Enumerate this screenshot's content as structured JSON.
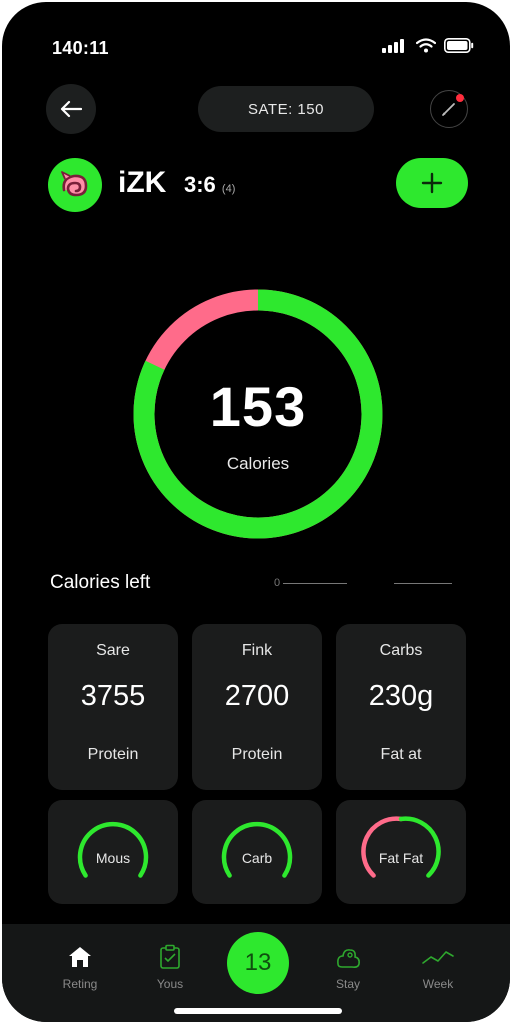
{
  "colors": {
    "accent": "#2ee82e",
    "ring_secondary": "#ff6b8a",
    "background": "#000000",
    "card": "#1b1c1c"
  },
  "status_bar": {
    "time": "140:11"
  },
  "header": {
    "date_label": "SATE: 150"
  },
  "profile": {
    "name": "iZK",
    "value": "3:6",
    "unit": "(4)"
  },
  "summary": {
    "value": "153",
    "label": "Calories",
    "progress_fraction": 0.82
  },
  "section": {
    "title": "Calories left",
    "legend_a": "0"
  },
  "cards": [
    {
      "title": "Sare",
      "value": "3755",
      "sub": "Protein"
    },
    {
      "title": "Fink",
      "value": "2700",
      "sub": "Protein"
    },
    {
      "title": "Carbs",
      "value": "230g",
      "sub": "Fat at"
    }
  ],
  "gauges": [
    {
      "label": "Mous",
      "color": "#2ee82e"
    },
    {
      "label": "Carb",
      "color": "#2ee82e"
    },
    {
      "label": "Fat Fat",
      "color": "#ff6b8a"
    }
  ],
  "nav": {
    "items": [
      {
        "label": "Reting",
        "icon": "home-icon"
      },
      {
        "label": "Yous",
        "icon": "clipboard-icon"
      },
      {
        "label": "Stay",
        "icon": "activity-icon"
      },
      {
        "label": "Week",
        "icon": "trend-icon"
      }
    ],
    "center_value": "13"
  }
}
